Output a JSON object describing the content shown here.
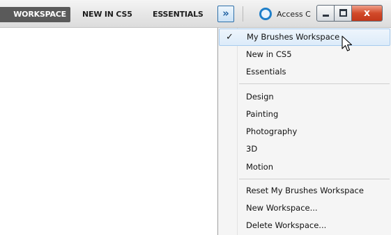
{
  "workspace_bar": {
    "active": "WORKSPACE",
    "tabs": [
      "NEW IN CS5",
      "ESSENTIALS"
    ],
    "overflow_glyph": "»",
    "cs_live_label": "Access C"
  },
  "window_controls": {
    "close_glyph": "x"
  },
  "menu": {
    "groups": [
      [
        {
          "label": "My Brushes Workspace",
          "checked": true
        },
        {
          "label": "New in CS5"
        },
        {
          "label": "Essentials"
        }
      ],
      [
        {
          "label": "Design"
        },
        {
          "label": "Painting"
        },
        {
          "label": "Photography"
        },
        {
          "label": "3D"
        },
        {
          "label": "Motion"
        }
      ],
      [
        {
          "label": "Reset My Brushes Workspace"
        },
        {
          "label": "New Workspace..."
        },
        {
          "label": "Delete Workspace..."
        }
      ]
    ],
    "check_glyph": "✓"
  },
  "colors": {
    "active_tab_bg": "#5a5a5a",
    "overflow_accent": "#1d5fa0",
    "cs_icon": "#1f7fc9",
    "close_red": "#d24a2a",
    "highlight_border": "#a7cbee"
  },
  "icons": [
    "overflow-chevrons-icon",
    "cs-live-icon",
    "minimize-icon",
    "maximize-icon",
    "close-icon",
    "checkmark-icon",
    "mouse-cursor-icon"
  ]
}
